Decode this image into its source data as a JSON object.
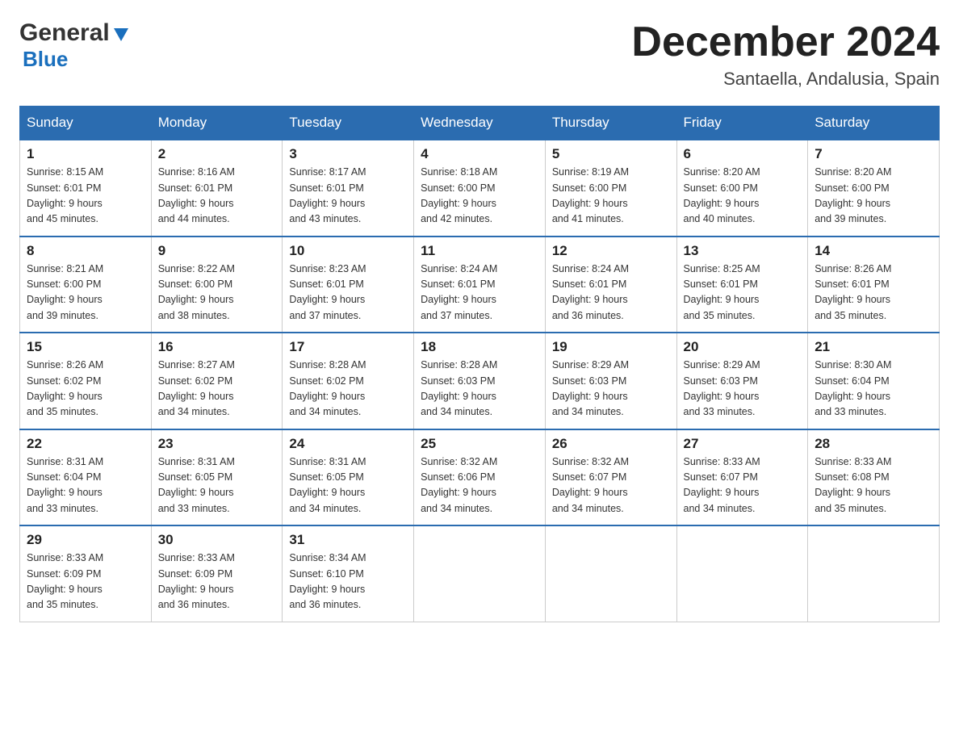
{
  "header": {
    "logo_general": "General",
    "logo_blue": "Blue",
    "month_title": "December 2024",
    "location": "Santaella, Andalusia, Spain"
  },
  "days_of_week": [
    "Sunday",
    "Monday",
    "Tuesday",
    "Wednesday",
    "Thursday",
    "Friday",
    "Saturday"
  ],
  "weeks": [
    [
      {
        "day": "1",
        "sunrise": "8:15 AM",
        "sunset": "6:01 PM",
        "daylight": "9 hours and 45 minutes."
      },
      {
        "day": "2",
        "sunrise": "8:16 AM",
        "sunset": "6:01 PM",
        "daylight": "9 hours and 44 minutes."
      },
      {
        "day": "3",
        "sunrise": "8:17 AM",
        "sunset": "6:01 PM",
        "daylight": "9 hours and 43 minutes."
      },
      {
        "day": "4",
        "sunrise": "8:18 AM",
        "sunset": "6:00 PM",
        "daylight": "9 hours and 42 minutes."
      },
      {
        "day": "5",
        "sunrise": "8:19 AM",
        "sunset": "6:00 PM",
        "daylight": "9 hours and 41 minutes."
      },
      {
        "day": "6",
        "sunrise": "8:20 AM",
        "sunset": "6:00 PM",
        "daylight": "9 hours and 40 minutes."
      },
      {
        "day": "7",
        "sunrise": "8:20 AM",
        "sunset": "6:00 PM",
        "daylight": "9 hours and 39 minutes."
      }
    ],
    [
      {
        "day": "8",
        "sunrise": "8:21 AM",
        "sunset": "6:00 PM",
        "daylight": "9 hours and 39 minutes."
      },
      {
        "day": "9",
        "sunrise": "8:22 AM",
        "sunset": "6:00 PM",
        "daylight": "9 hours and 38 minutes."
      },
      {
        "day": "10",
        "sunrise": "8:23 AM",
        "sunset": "6:01 PM",
        "daylight": "9 hours and 37 minutes."
      },
      {
        "day": "11",
        "sunrise": "8:24 AM",
        "sunset": "6:01 PM",
        "daylight": "9 hours and 37 minutes."
      },
      {
        "day": "12",
        "sunrise": "8:24 AM",
        "sunset": "6:01 PM",
        "daylight": "9 hours and 36 minutes."
      },
      {
        "day": "13",
        "sunrise": "8:25 AM",
        "sunset": "6:01 PM",
        "daylight": "9 hours and 35 minutes."
      },
      {
        "day": "14",
        "sunrise": "8:26 AM",
        "sunset": "6:01 PM",
        "daylight": "9 hours and 35 minutes."
      }
    ],
    [
      {
        "day": "15",
        "sunrise": "8:26 AM",
        "sunset": "6:02 PM",
        "daylight": "9 hours and 35 minutes."
      },
      {
        "day": "16",
        "sunrise": "8:27 AM",
        "sunset": "6:02 PM",
        "daylight": "9 hours and 34 minutes."
      },
      {
        "day": "17",
        "sunrise": "8:28 AM",
        "sunset": "6:02 PM",
        "daylight": "9 hours and 34 minutes."
      },
      {
        "day": "18",
        "sunrise": "8:28 AM",
        "sunset": "6:03 PM",
        "daylight": "9 hours and 34 minutes."
      },
      {
        "day": "19",
        "sunrise": "8:29 AM",
        "sunset": "6:03 PM",
        "daylight": "9 hours and 34 minutes."
      },
      {
        "day": "20",
        "sunrise": "8:29 AM",
        "sunset": "6:03 PM",
        "daylight": "9 hours and 33 minutes."
      },
      {
        "day": "21",
        "sunrise": "8:30 AM",
        "sunset": "6:04 PM",
        "daylight": "9 hours and 33 minutes."
      }
    ],
    [
      {
        "day": "22",
        "sunrise": "8:31 AM",
        "sunset": "6:04 PM",
        "daylight": "9 hours and 33 minutes."
      },
      {
        "day": "23",
        "sunrise": "8:31 AM",
        "sunset": "6:05 PM",
        "daylight": "9 hours and 33 minutes."
      },
      {
        "day": "24",
        "sunrise": "8:31 AM",
        "sunset": "6:05 PM",
        "daylight": "9 hours and 34 minutes."
      },
      {
        "day": "25",
        "sunrise": "8:32 AM",
        "sunset": "6:06 PM",
        "daylight": "9 hours and 34 minutes."
      },
      {
        "day": "26",
        "sunrise": "8:32 AM",
        "sunset": "6:07 PM",
        "daylight": "9 hours and 34 minutes."
      },
      {
        "day": "27",
        "sunrise": "8:33 AM",
        "sunset": "6:07 PM",
        "daylight": "9 hours and 34 minutes."
      },
      {
        "day": "28",
        "sunrise": "8:33 AM",
        "sunset": "6:08 PM",
        "daylight": "9 hours and 35 minutes."
      }
    ],
    [
      {
        "day": "29",
        "sunrise": "8:33 AM",
        "sunset": "6:09 PM",
        "daylight": "9 hours and 35 minutes."
      },
      {
        "day": "30",
        "sunrise": "8:33 AM",
        "sunset": "6:09 PM",
        "daylight": "9 hours and 36 minutes."
      },
      {
        "day": "31",
        "sunrise": "8:34 AM",
        "sunset": "6:10 PM",
        "daylight": "9 hours and 36 minutes."
      },
      null,
      null,
      null,
      null
    ]
  ],
  "labels": {
    "sunrise": "Sunrise:",
    "sunset": "Sunset:",
    "daylight": "Daylight:"
  }
}
